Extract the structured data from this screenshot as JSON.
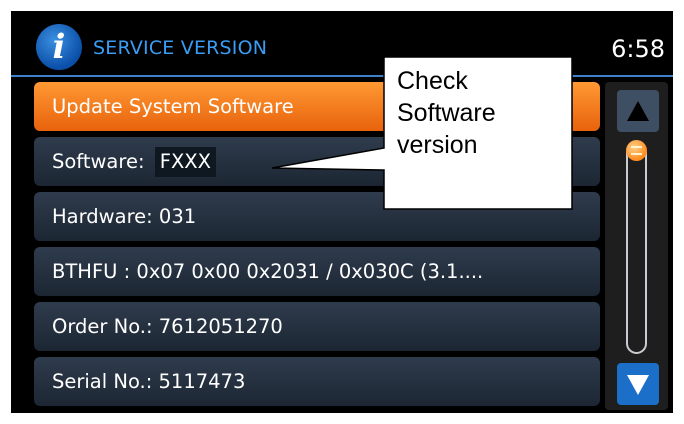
{
  "header": {
    "icon": "info-icon",
    "icon_glyph": "i",
    "title": "SERVICE VERSION",
    "clock": "6:58"
  },
  "menu": {
    "update": "Update System Software",
    "software_label": "Software:",
    "software_value": "FXXX",
    "hardware": "Hardware: 031",
    "bthfu": "BTHFU : 0x07 0x00 0x2031 / 0x030C (3.1....",
    "order": "Order No.: 7612051270",
    "serial": "Serial No.: 5117473"
  },
  "scrollbar": {
    "up_icon": "triangle-up-icon",
    "down_icon": "triangle-down-icon",
    "position": 0
  },
  "callout": {
    "lines": [
      "Check",
      "Software",
      "version"
    ]
  },
  "colors": {
    "accent": "#3a9df5",
    "active_item": "#ff8c2a",
    "item_bg": "#253141",
    "screen_bg": "#000000"
  }
}
